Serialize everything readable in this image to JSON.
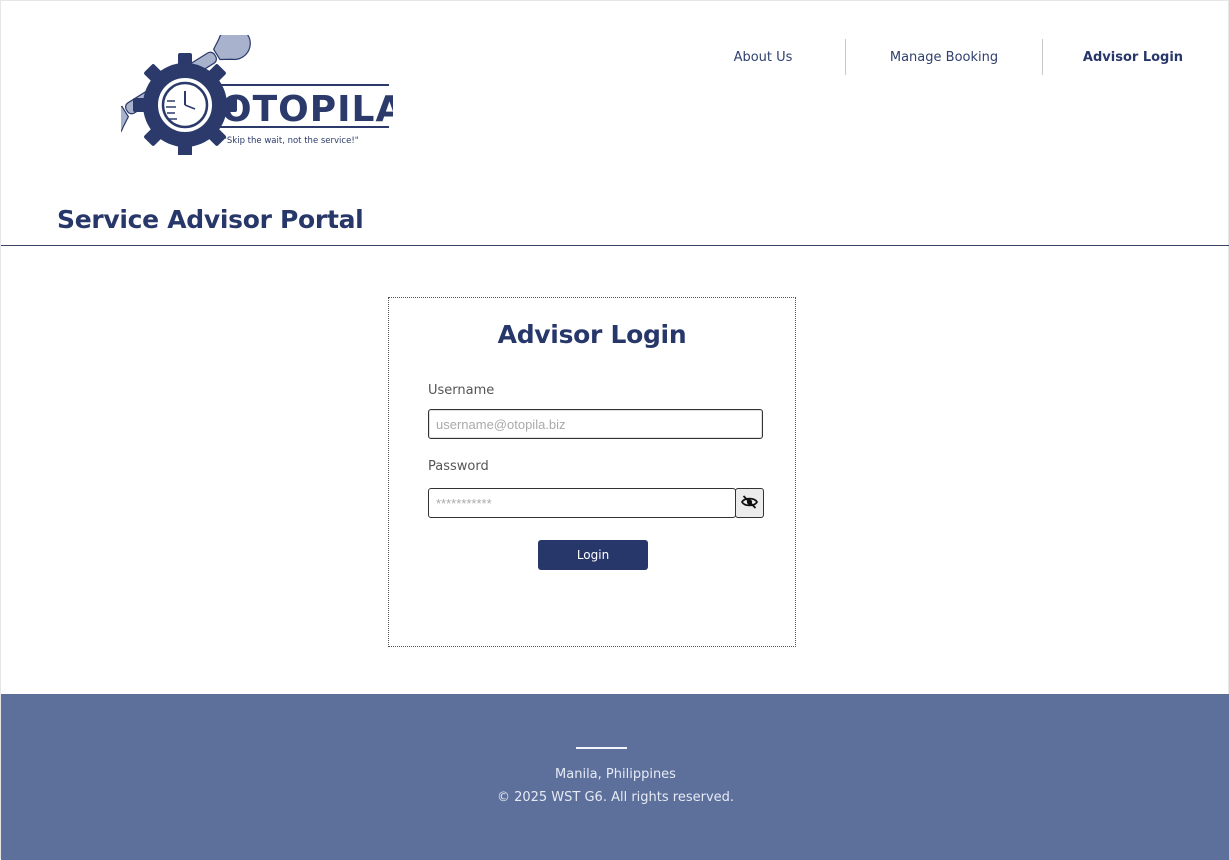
{
  "brand": {
    "logo_text": "OTOPILA",
    "tagline": "\"Skip the wait, not the service!\""
  },
  "nav": {
    "items": [
      {
        "label": "About Us"
      },
      {
        "label": "Manage Booking"
      },
      {
        "label": "Advisor Login",
        "active": true
      }
    ]
  },
  "page": {
    "title": "Service Advisor Portal"
  },
  "login": {
    "title": "Advisor Login",
    "username_label": "Username",
    "username_placeholder": "username@otopila.biz",
    "username_value": "",
    "password_label": "Password",
    "password_placeholder": "***********",
    "password_value": "",
    "toggle_icon": "eye-slash-icon",
    "submit_label": "Login"
  },
  "footer": {
    "location": "Manila, Philippines",
    "copyright": "© 2025 WST G6.  All rights reserved."
  },
  "colors": {
    "primary": "#27376a",
    "footer_bg": "#5d709b",
    "background": "#ffffff"
  }
}
